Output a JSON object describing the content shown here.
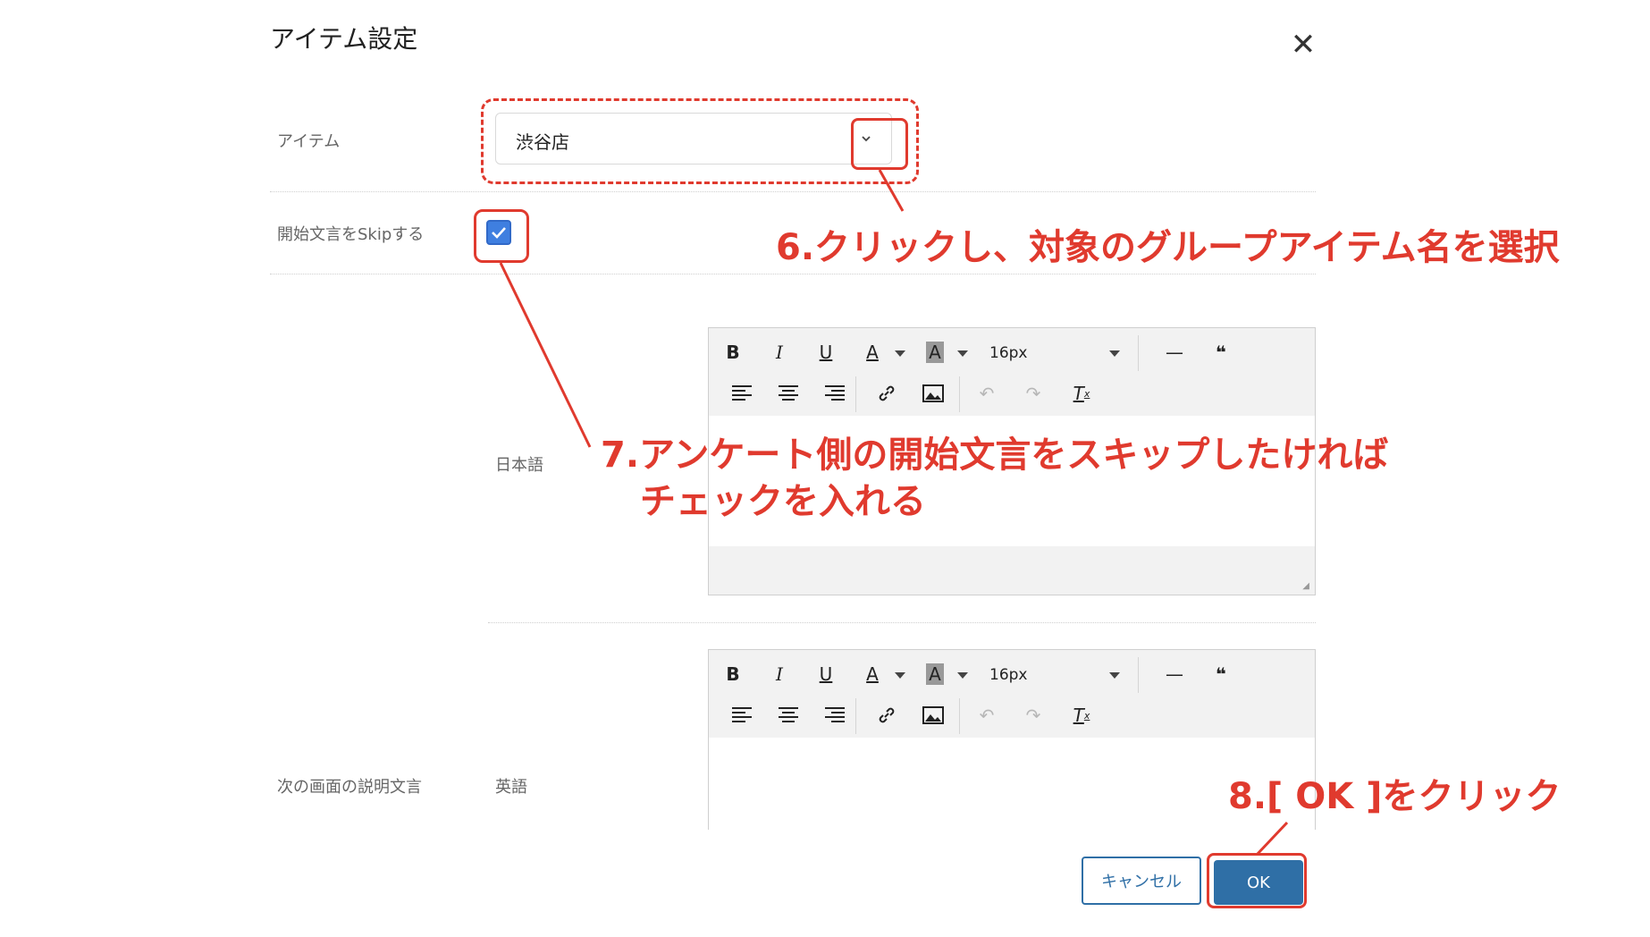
{
  "dialog": {
    "title": "アイテム設定"
  },
  "fields": {
    "item_label": "アイテム",
    "item_value": "渋谷店",
    "skip_label": "開始文言をSkipする",
    "skip_checked": true,
    "next_desc_label": "次の画面の説明文言",
    "lang_ja": "日本語",
    "lang_en": "英語"
  },
  "toolbar": {
    "bold": "B",
    "italic": "I",
    "underline": "U",
    "text_color": "A",
    "bg_color": "A",
    "font_size": "16px",
    "hr": "—",
    "quote": "❝"
  },
  "annotations": {
    "step6": "6.クリックし、対象のグループアイテム名を選択",
    "step7_line1": "7.アンケート側の開始文言をスキップしたければ",
    "step7_line2": "チェックを入れる",
    "step8": "8.[ OK ]をクリック"
  },
  "buttons": {
    "cancel": "キャンセル",
    "ok": "OK"
  },
  "colors": {
    "annotation": "#e03a2e",
    "primary": "#2f6fa6",
    "checkbox": "#3f7fe0"
  }
}
